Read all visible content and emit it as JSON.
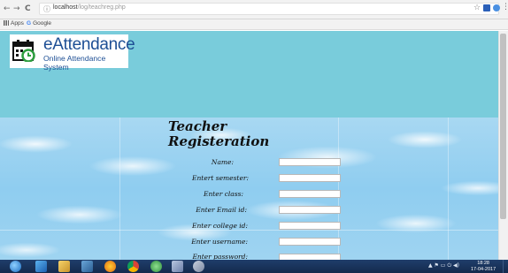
{
  "browser": {
    "back_icon": "←",
    "forward_icon": "→",
    "reload_icon": "C",
    "info_icon": "ⓘ",
    "url_host": "localhost",
    "url_path": "/log/teachreg.php",
    "star_icon": "☆",
    "menu_icon": "⋮",
    "bookmarks": {
      "apps": "Apps",
      "google": "Google",
      "google_icon": "G"
    }
  },
  "header": {
    "brand": "eAttendance",
    "tagline": "Online Attendance System",
    "colors": {
      "banner": "#79ccdb",
      "brand_text": "#1e4f95"
    }
  },
  "form": {
    "title_line1": "Teacher",
    "title_line2": "Registeration",
    "fields": [
      {
        "label": "Name:",
        "value": ""
      },
      {
        "label": "Entert semester:",
        "value": ""
      },
      {
        "label": "Enter class:",
        "value": ""
      },
      {
        "label": "Enter Email id:",
        "value": ""
      },
      {
        "label": "Enter college id:",
        "value": ""
      },
      {
        "label": "Enter username:",
        "value": ""
      },
      {
        "label": "Enter password:",
        "value": ""
      }
    ]
  },
  "taskbar": {
    "clock_time": "18:28",
    "clock_date": "17-04-2017",
    "tray_icons": "▲ ⚑ ▭ ⏻ ◀)"
  }
}
